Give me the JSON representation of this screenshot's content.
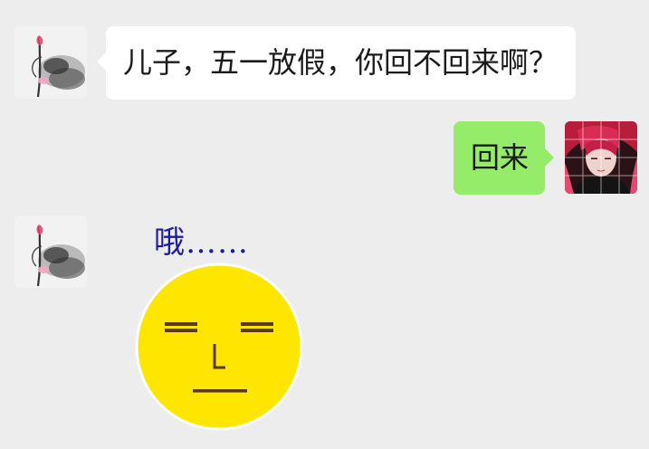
{
  "chat": {
    "messages": [
      {
        "side": "left",
        "type": "text",
        "text": "儿子，五一放假，你回不回来啊？",
        "avatar_icon": "ink-lotus-avatar"
      },
      {
        "side": "right",
        "type": "text",
        "text": "回来",
        "avatar_icon": "red-hair-portrait-avatar"
      },
      {
        "side": "left",
        "type": "sticker",
        "caption": "哦……",
        "sticker_icon": "yellow-face-sticker",
        "avatar_icon": "ink-lotus-avatar"
      }
    ]
  },
  "colors": {
    "background": "#ededed",
    "incoming_bubble": "#ffffff",
    "outgoing_bubble": "#95ec69",
    "sticker_face": "#ffe600",
    "sticker_caption": "#1c1c9e"
  }
}
